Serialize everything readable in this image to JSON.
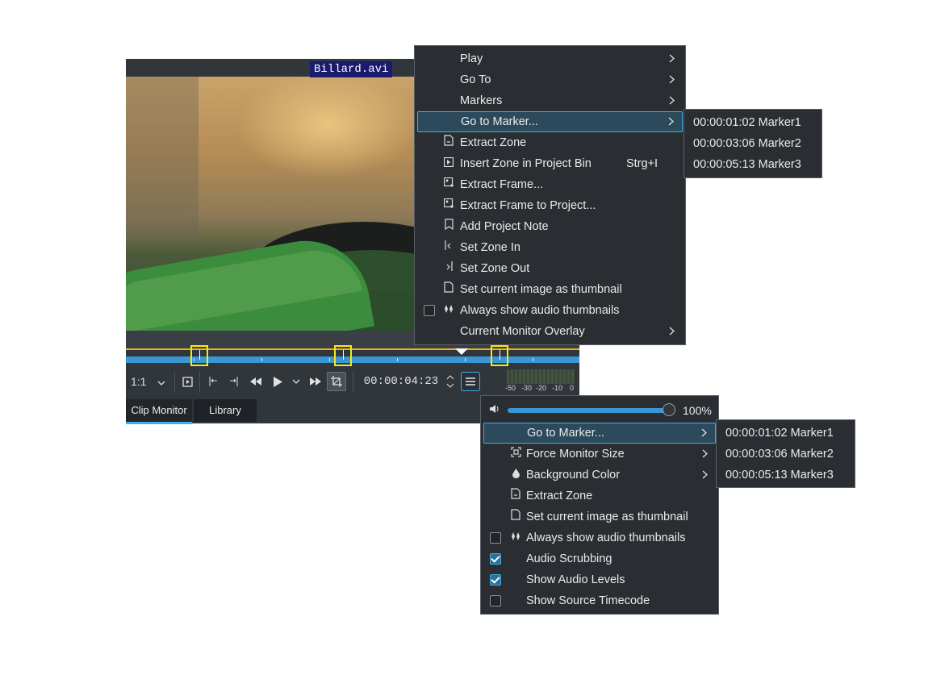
{
  "monitor": {
    "clip_name": "Billard.avi",
    "zoom": "1:1",
    "timecode": "00:00:04:23",
    "audio_scale": [
      "-50",
      "-30",
      "-20",
      "-10",
      "0"
    ],
    "tabs": [
      {
        "label": "Clip Monitor",
        "active": true
      },
      {
        "label": "Library",
        "active": false
      }
    ],
    "accent": "#3daee9",
    "zone_color": "#e7b21c",
    "marker_highlight_color": "#f5ea14"
  },
  "context_menu": {
    "items": [
      {
        "label": "Play",
        "icon": "",
        "submenu": true
      },
      {
        "label": "Go To",
        "icon": "",
        "submenu": true
      },
      {
        "label": "Markers",
        "icon": "",
        "submenu": true
      },
      {
        "label": "Go to Marker...",
        "icon": "",
        "submenu": true,
        "highlighted": true
      },
      {
        "label": "Extract Zone",
        "icon": "extract-zone-icon"
      },
      {
        "label": "Insert Zone in Project Bin",
        "icon": "insert-zone-icon",
        "shortcut": "Strg+I"
      },
      {
        "label": "Extract Frame...",
        "icon": "extract-frame-icon"
      },
      {
        "label": "Extract Frame to Project...",
        "icon": "extract-frame-project-icon"
      },
      {
        "label": "Add Project Note",
        "icon": "project-note-icon"
      },
      {
        "label": "Set Zone In",
        "icon": "zone-in-icon"
      },
      {
        "label": "Set Zone Out",
        "icon": "zone-out-icon"
      },
      {
        "label": "Set current image as thumbnail",
        "icon": "thumbnail-icon"
      },
      {
        "label": "Always show audio thumbnails",
        "icon": "audio-thumbnail-icon",
        "checkbox": true,
        "checked": false
      },
      {
        "label": "Current Monitor Overlay",
        "icon": "",
        "submenu": true
      }
    ]
  },
  "marker_submenu_1": {
    "items": [
      "00:00:01:02 Marker1",
      "00:00:03:06 Marker2",
      "00:00:05:13 Marker3"
    ]
  },
  "options_menu": {
    "volume": "100%",
    "volume_level": 1.0,
    "items": [
      {
        "label": "Go to Marker...",
        "icon": "",
        "submenu": true,
        "highlighted": true
      },
      {
        "label": "Force Monitor Size",
        "icon": "monitor-size-icon",
        "submenu": true
      },
      {
        "label": "Background Color",
        "icon": "color-icon",
        "submenu": true
      },
      {
        "label": "Extract Zone",
        "icon": "extract-zone-icon"
      },
      {
        "label": "Set current image as thumbnail",
        "icon": "thumbnail-icon"
      },
      {
        "label": "Always show audio thumbnails",
        "icon": "audio-thumbnail-icon",
        "checkbox": true,
        "checked": false
      },
      {
        "label": "Audio Scrubbing",
        "icon": "",
        "checkbox": true,
        "checked": true
      },
      {
        "label": "Show Audio Levels",
        "icon": "",
        "checkbox": true,
        "checked": true
      },
      {
        "label": "Show Source Timecode",
        "icon": "",
        "checkbox": true,
        "checked": false
      }
    ]
  },
  "marker_submenu_2": {
    "items": [
      "00:00:01:02 Marker1",
      "00:00:03:06 Marker2",
      "00:00:05:13 Marker3"
    ]
  }
}
